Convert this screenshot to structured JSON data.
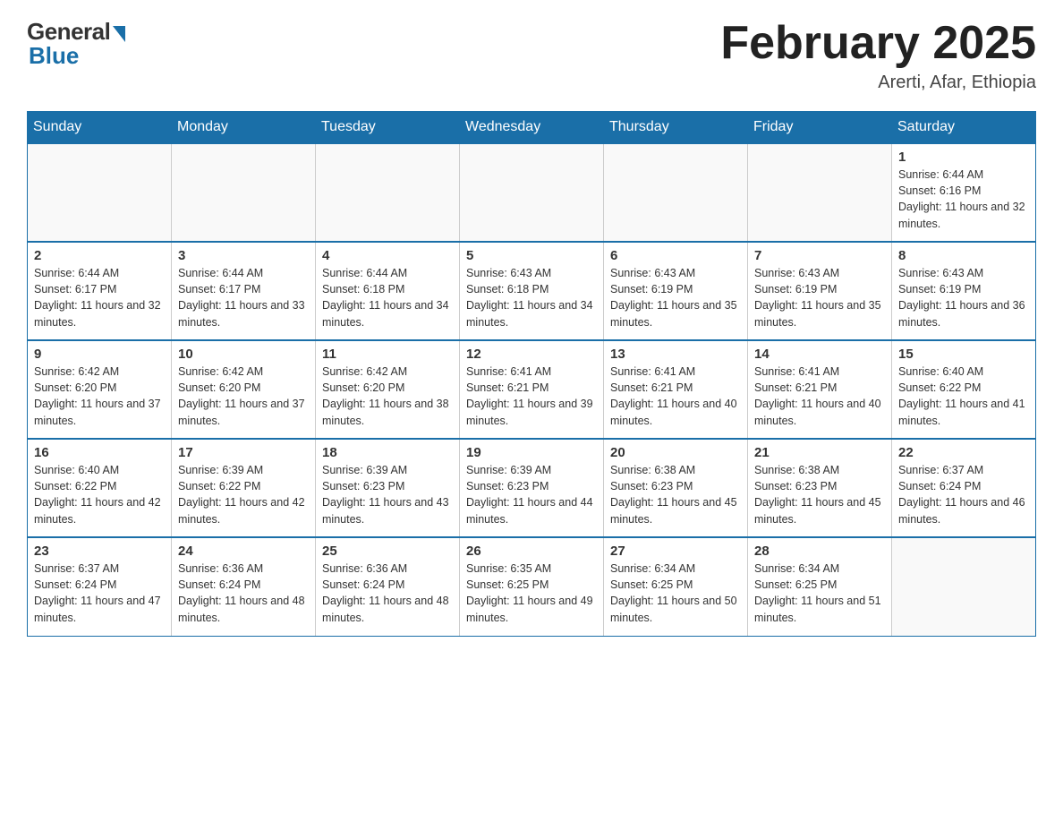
{
  "header": {
    "logo_general": "General",
    "logo_blue": "Blue",
    "month_title": "February 2025",
    "location": "Arerti, Afar, Ethiopia"
  },
  "days_of_week": [
    "Sunday",
    "Monday",
    "Tuesday",
    "Wednesday",
    "Thursday",
    "Friday",
    "Saturday"
  ],
  "weeks": [
    [
      {
        "day": "",
        "info": ""
      },
      {
        "day": "",
        "info": ""
      },
      {
        "day": "",
        "info": ""
      },
      {
        "day": "",
        "info": ""
      },
      {
        "day": "",
        "info": ""
      },
      {
        "day": "",
        "info": ""
      },
      {
        "day": "1",
        "info": "Sunrise: 6:44 AM\nSunset: 6:16 PM\nDaylight: 11 hours and 32 minutes."
      }
    ],
    [
      {
        "day": "2",
        "info": "Sunrise: 6:44 AM\nSunset: 6:17 PM\nDaylight: 11 hours and 32 minutes."
      },
      {
        "day": "3",
        "info": "Sunrise: 6:44 AM\nSunset: 6:17 PM\nDaylight: 11 hours and 33 minutes."
      },
      {
        "day": "4",
        "info": "Sunrise: 6:44 AM\nSunset: 6:18 PM\nDaylight: 11 hours and 34 minutes."
      },
      {
        "day": "5",
        "info": "Sunrise: 6:43 AM\nSunset: 6:18 PM\nDaylight: 11 hours and 34 minutes."
      },
      {
        "day": "6",
        "info": "Sunrise: 6:43 AM\nSunset: 6:19 PM\nDaylight: 11 hours and 35 minutes."
      },
      {
        "day": "7",
        "info": "Sunrise: 6:43 AM\nSunset: 6:19 PM\nDaylight: 11 hours and 35 minutes."
      },
      {
        "day": "8",
        "info": "Sunrise: 6:43 AM\nSunset: 6:19 PM\nDaylight: 11 hours and 36 minutes."
      }
    ],
    [
      {
        "day": "9",
        "info": "Sunrise: 6:42 AM\nSunset: 6:20 PM\nDaylight: 11 hours and 37 minutes."
      },
      {
        "day": "10",
        "info": "Sunrise: 6:42 AM\nSunset: 6:20 PM\nDaylight: 11 hours and 37 minutes."
      },
      {
        "day": "11",
        "info": "Sunrise: 6:42 AM\nSunset: 6:20 PM\nDaylight: 11 hours and 38 minutes."
      },
      {
        "day": "12",
        "info": "Sunrise: 6:41 AM\nSunset: 6:21 PM\nDaylight: 11 hours and 39 minutes."
      },
      {
        "day": "13",
        "info": "Sunrise: 6:41 AM\nSunset: 6:21 PM\nDaylight: 11 hours and 40 minutes."
      },
      {
        "day": "14",
        "info": "Sunrise: 6:41 AM\nSunset: 6:21 PM\nDaylight: 11 hours and 40 minutes."
      },
      {
        "day": "15",
        "info": "Sunrise: 6:40 AM\nSunset: 6:22 PM\nDaylight: 11 hours and 41 minutes."
      }
    ],
    [
      {
        "day": "16",
        "info": "Sunrise: 6:40 AM\nSunset: 6:22 PM\nDaylight: 11 hours and 42 minutes."
      },
      {
        "day": "17",
        "info": "Sunrise: 6:39 AM\nSunset: 6:22 PM\nDaylight: 11 hours and 42 minutes."
      },
      {
        "day": "18",
        "info": "Sunrise: 6:39 AM\nSunset: 6:23 PM\nDaylight: 11 hours and 43 minutes."
      },
      {
        "day": "19",
        "info": "Sunrise: 6:39 AM\nSunset: 6:23 PM\nDaylight: 11 hours and 44 minutes."
      },
      {
        "day": "20",
        "info": "Sunrise: 6:38 AM\nSunset: 6:23 PM\nDaylight: 11 hours and 45 minutes."
      },
      {
        "day": "21",
        "info": "Sunrise: 6:38 AM\nSunset: 6:23 PM\nDaylight: 11 hours and 45 minutes."
      },
      {
        "day": "22",
        "info": "Sunrise: 6:37 AM\nSunset: 6:24 PM\nDaylight: 11 hours and 46 minutes."
      }
    ],
    [
      {
        "day": "23",
        "info": "Sunrise: 6:37 AM\nSunset: 6:24 PM\nDaylight: 11 hours and 47 minutes."
      },
      {
        "day": "24",
        "info": "Sunrise: 6:36 AM\nSunset: 6:24 PM\nDaylight: 11 hours and 48 minutes."
      },
      {
        "day": "25",
        "info": "Sunrise: 6:36 AM\nSunset: 6:24 PM\nDaylight: 11 hours and 48 minutes."
      },
      {
        "day": "26",
        "info": "Sunrise: 6:35 AM\nSunset: 6:25 PM\nDaylight: 11 hours and 49 minutes."
      },
      {
        "day": "27",
        "info": "Sunrise: 6:34 AM\nSunset: 6:25 PM\nDaylight: 11 hours and 50 minutes."
      },
      {
        "day": "28",
        "info": "Sunrise: 6:34 AM\nSunset: 6:25 PM\nDaylight: 11 hours and 51 minutes."
      },
      {
        "day": "",
        "info": ""
      }
    ]
  ]
}
